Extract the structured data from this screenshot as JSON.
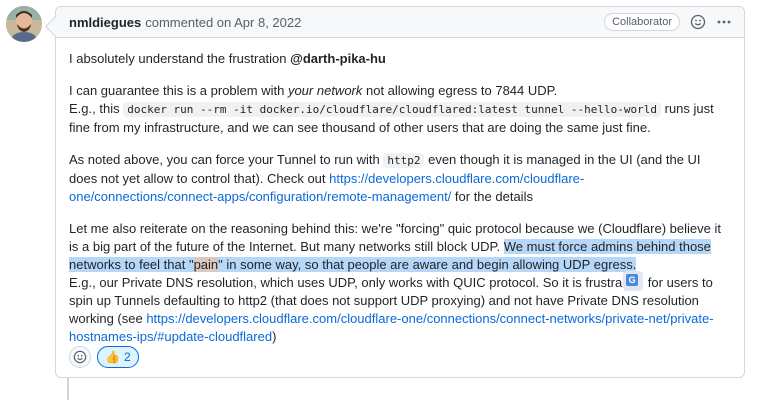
{
  "comment": {
    "author": "nmldiegues",
    "commented_text": "commented on Apr 8, 2022",
    "badge": "Collaborator",
    "icons": {
      "emoji": "smiley-icon",
      "more": "kebab-icon",
      "translate": "translate-icon"
    }
  },
  "body": {
    "p1_text": "I absolutely understand the frustration ",
    "p1_mention": "@darth-pika-hu",
    "p2_a": "I can guarantee this is a problem with ",
    "p2_em": "your network",
    "p2_b": " not allowing egress to 7844 UDP.",
    "p2_c": "E.g., this ",
    "p2_code": "docker run --rm -it docker.io/cloudflare/cloudflared:latest tunnel --hello-world",
    "p2_d": " runs just fine from my infrastructure, and we can see thousand of other users that are doing the same just fine.",
    "p3_a": "As noted above, you can force your Tunnel to run with ",
    "p3_code": "http2",
    "p3_b": " even though it is managed in the UI (and the UI does not yet allow to control that). Check out ",
    "p3_link": "https://developers.cloudflare.com/cloudflare-one/connections/connect-apps/configuration/remote-management/",
    "p3_c": " for the details",
    "p4_a": "Let me also reiterate on the reasoning behind this: we're \"forcing\" quic protocol because we (Cloudflare) believe it is a big part of the future of the Internet. But many networks still block UDP. ",
    "p4_hl1": "We must force admins behind those networks to feel that \"",
    "p4_pain": "pain",
    "p4_hl2": "\" in some way, so that people are aware and begin allowing UDP egress.",
    "p4_b": "E.g., our Private DNS resolution, which uses UDP, only works with QUIC protocol. So it is frustra",
    "p4_c": " for users to spin up Tunnels defaulting to http2 (that does not support UDP proxying) and not have Private DNS resolution working (see ",
    "p4_link": "https://developers.cloudflare.com/cloudflare-one/connections/connect-networks/private-net/private-hostnames-ips/#update-cloudflared",
    "p4_d": ")"
  },
  "reactions": {
    "thumbs_emoji": "👍",
    "thumbs_count": "2"
  }
}
